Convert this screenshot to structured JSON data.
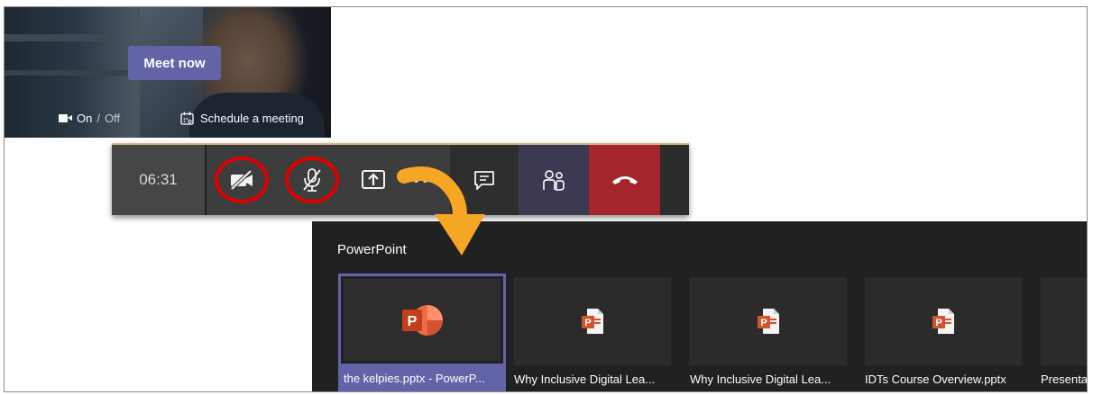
{
  "video_preview": {
    "meet_now_label": "Meet now",
    "video_on_label": "On",
    "separator": "/",
    "video_off_label": "Off",
    "schedule_label": "Schedule a meeting"
  },
  "call_controls": {
    "timer": "06:31",
    "camera_state": "off",
    "mic_state": "muted",
    "buttons": [
      "camera-off",
      "mic-off",
      "share",
      "more",
      "chat",
      "participants",
      "hang-up"
    ]
  },
  "share_panel": {
    "heading": "PowerPoint",
    "files": [
      {
        "name": "the kelpies.pptx - PowerP...",
        "icon": "powerpoint-logo-icon",
        "selected": true
      },
      {
        "name": "Why Inclusive Digital Lea...",
        "icon": "pptx-file-icon",
        "selected": false
      },
      {
        "name": "Why Inclusive Digital Lea...",
        "icon": "pptx-file-icon",
        "selected": false
      },
      {
        "name": "IDTs Course Overview.pptx",
        "icon": "pptx-file-icon",
        "selected": false
      },
      {
        "name": "Presenta",
        "icon": "pptx-file-icon",
        "selected": false
      }
    ]
  },
  "colors": {
    "teams_purple": "#6264a7",
    "hangup_red": "#a4262c",
    "annotation_red": "#e00000",
    "annotation_arrow": "#f5a623",
    "panel_bg": "#212121",
    "ppt_orange": "#d35230"
  }
}
